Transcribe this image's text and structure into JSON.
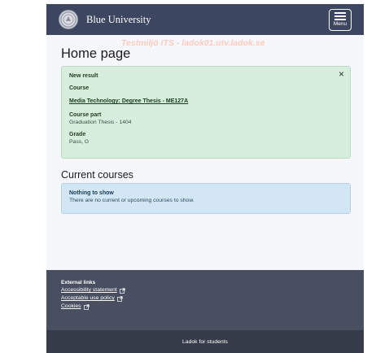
{
  "header": {
    "brand": "Blue University",
    "menu_label": "Menu"
  },
  "watermark": "Testmiljö ITS - ladok01.utv.ladok.se",
  "main": {
    "title": "Home page",
    "result_alert": {
      "heading": "New result",
      "course_label": "Course",
      "course_link": "Media Technology: Degree Thesis - ME127A",
      "course_part_label": "Course part",
      "course_part_value": "Graduation Thesis - 1404",
      "grade_label": "Grade",
      "grade_value": "Pass, G",
      "close_symbol": "×"
    },
    "current_courses": {
      "title": "Current courses",
      "alert_heading": "Nothing to show",
      "alert_text": "There are no current or upcoming courses to show."
    }
  },
  "footer": {
    "external_links_title": "External links",
    "links": [
      "Accessibility statement",
      "Acceptable use policy",
      "Cookies"
    ],
    "bottom_text": "Ladok for students"
  },
  "colors": {
    "header_bg": "#3d4660",
    "success_bg": "#d6eedb",
    "info_bg": "#d2e6f3",
    "footer_bg": "#484f61",
    "bottombar_bg": "#353b49"
  }
}
